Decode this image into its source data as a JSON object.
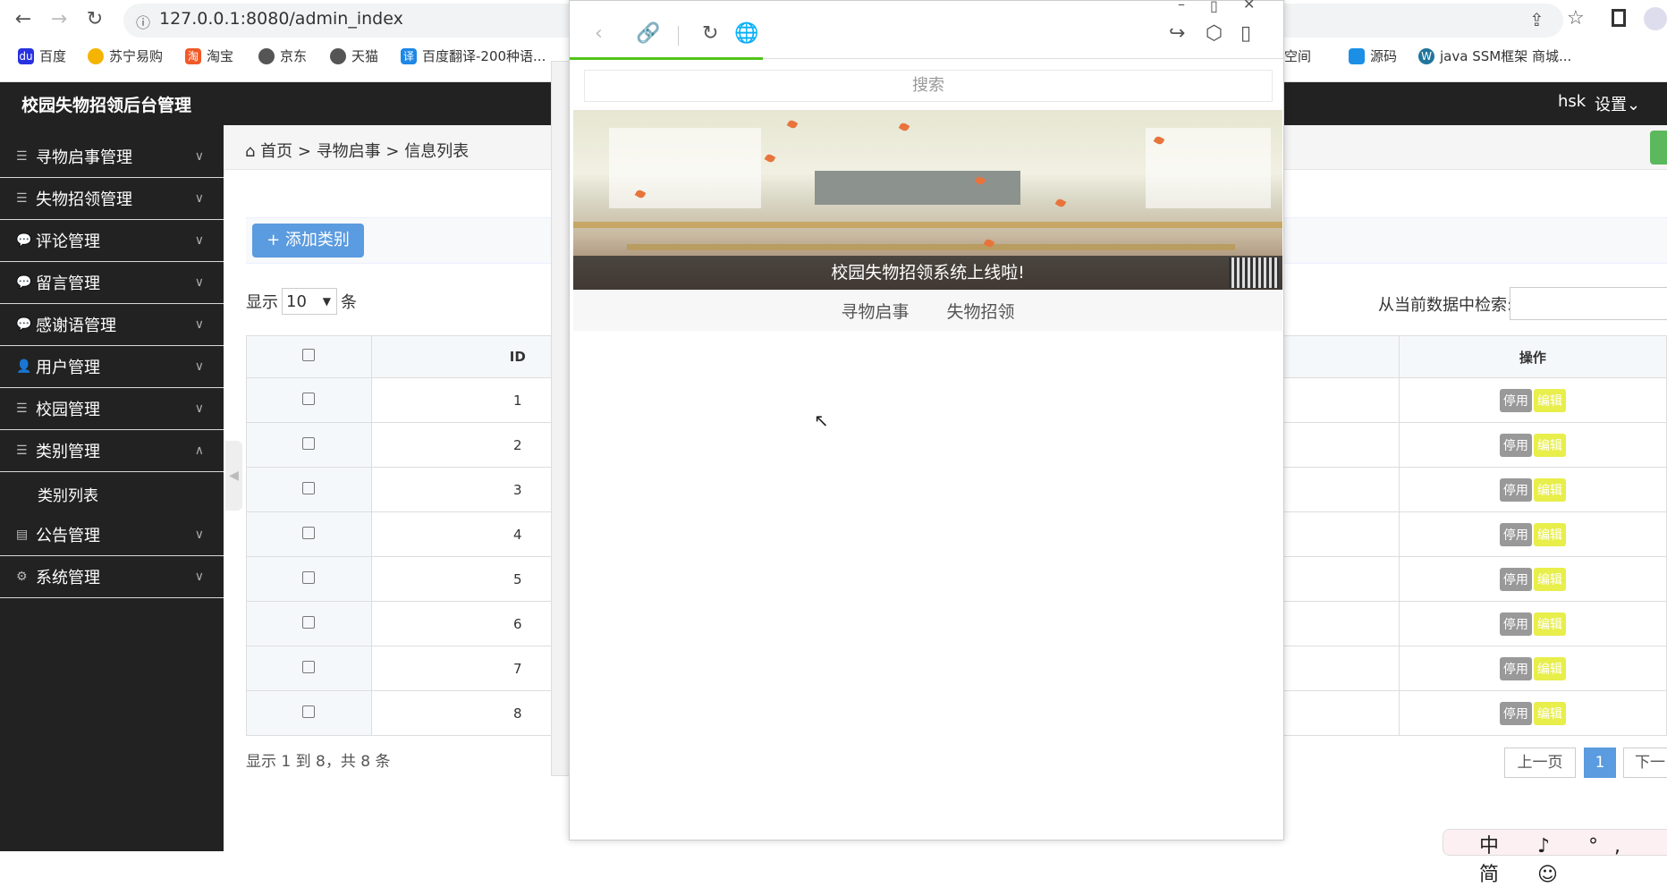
{
  "browser": {
    "url": "127.0.0.1:8080/admin_index",
    "bookmarks": [
      "百度",
      "苏宁易购",
      "淘宝",
      "京东",
      "天猫",
      "百度翻译-200种语...",
      "空间",
      "源码",
      "java SSM框架 商城..."
    ]
  },
  "header": {
    "brand": "校园失物招领后台管理",
    "user": "hsk",
    "settings": "设置"
  },
  "sidebar": {
    "items": [
      {
        "label": "寻物启事管理",
        "icon": "list-icon"
      },
      {
        "label": "失物招领管理",
        "icon": "list-icon"
      },
      {
        "label": "评论管理",
        "icon": "comment-icon"
      },
      {
        "label": "留言管理",
        "icon": "comment-icon"
      },
      {
        "label": "感谢语管理",
        "icon": "comment-icon"
      },
      {
        "label": "用户管理",
        "icon": "user-icon"
      },
      {
        "label": "校园管理",
        "icon": "list-icon"
      },
      {
        "label": "类别管理",
        "icon": "list-icon",
        "expanded": true
      },
      {
        "label": "类别列表",
        "sub": true
      },
      {
        "label": "公告管理",
        "icon": "notice-icon"
      },
      {
        "label": "系统管理",
        "icon": "gear-icon"
      }
    ]
  },
  "breadcrumb": [
    "首页",
    "寻物启事",
    "信息列表"
  ],
  "toolbar": {
    "add_label": "添加类别"
  },
  "table_controls": {
    "show": "显示",
    "page_size": "10",
    "unit": "条",
    "search_label": "从当前数据中检索:"
  },
  "table": {
    "headers": [
      "ID",
      "操作"
    ],
    "rows": [
      "1",
      "2",
      "3",
      "4",
      "5",
      "6",
      "7",
      "8"
    ],
    "disable_label": "停用",
    "edit_label": "编辑"
  },
  "footer": {
    "info": "显示 1 到 8，共 8 条",
    "prev": "上一页",
    "page": "1",
    "next": "下一"
  },
  "popup": {
    "search_placeholder": "搜索",
    "caption": "校园失物招领系统上线啦!",
    "tabs": [
      "寻物启事",
      "失物招领"
    ],
    "load_progress": 0.27
  },
  "ime": {
    "text": "中 ♪ °, 简 ☺"
  }
}
